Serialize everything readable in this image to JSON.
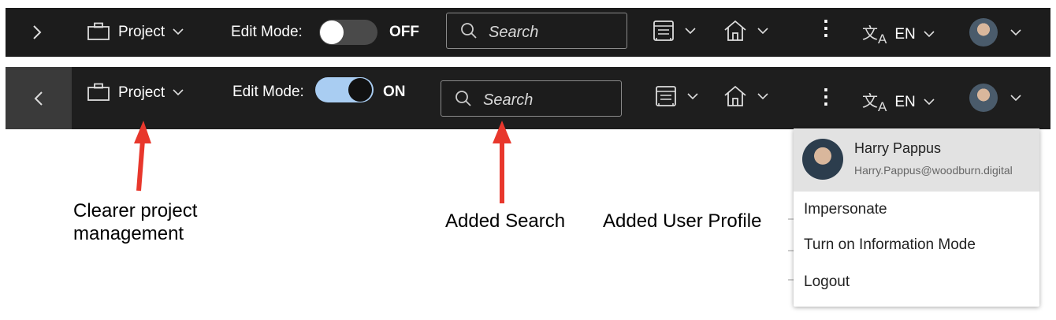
{
  "bar_off": {
    "nav_arrow": "›",
    "project_label": "Project",
    "edit_mode_label": "Edit Mode:",
    "edit_mode_state": "OFF",
    "search_placeholder": "Search",
    "language": "EN"
  },
  "bar_on": {
    "nav_arrow": "‹",
    "project_label": "Project",
    "edit_mode_label": "Edit Mode:",
    "edit_mode_state": "ON",
    "search_placeholder": "Search",
    "language": "EN"
  },
  "annotations": {
    "project": "Clearer project\nmanagement",
    "search": "Added Search",
    "profile": "Added User Profile"
  },
  "user_menu": {
    "name": "Harry Pappus",
    "email": "Harry.Pappus@woodburn.digital",
    "items": [
      "Impersonate",
      "Turn on Information Mode",
      "Logout"
    ]
  },
  "colors": {
    "bar": "#1c1c1c",
    "toggle_on": "#a9cdf2",
    "toggle_off": "#4a4a4a",
    "arrow": "#e8372c"
  }
}
